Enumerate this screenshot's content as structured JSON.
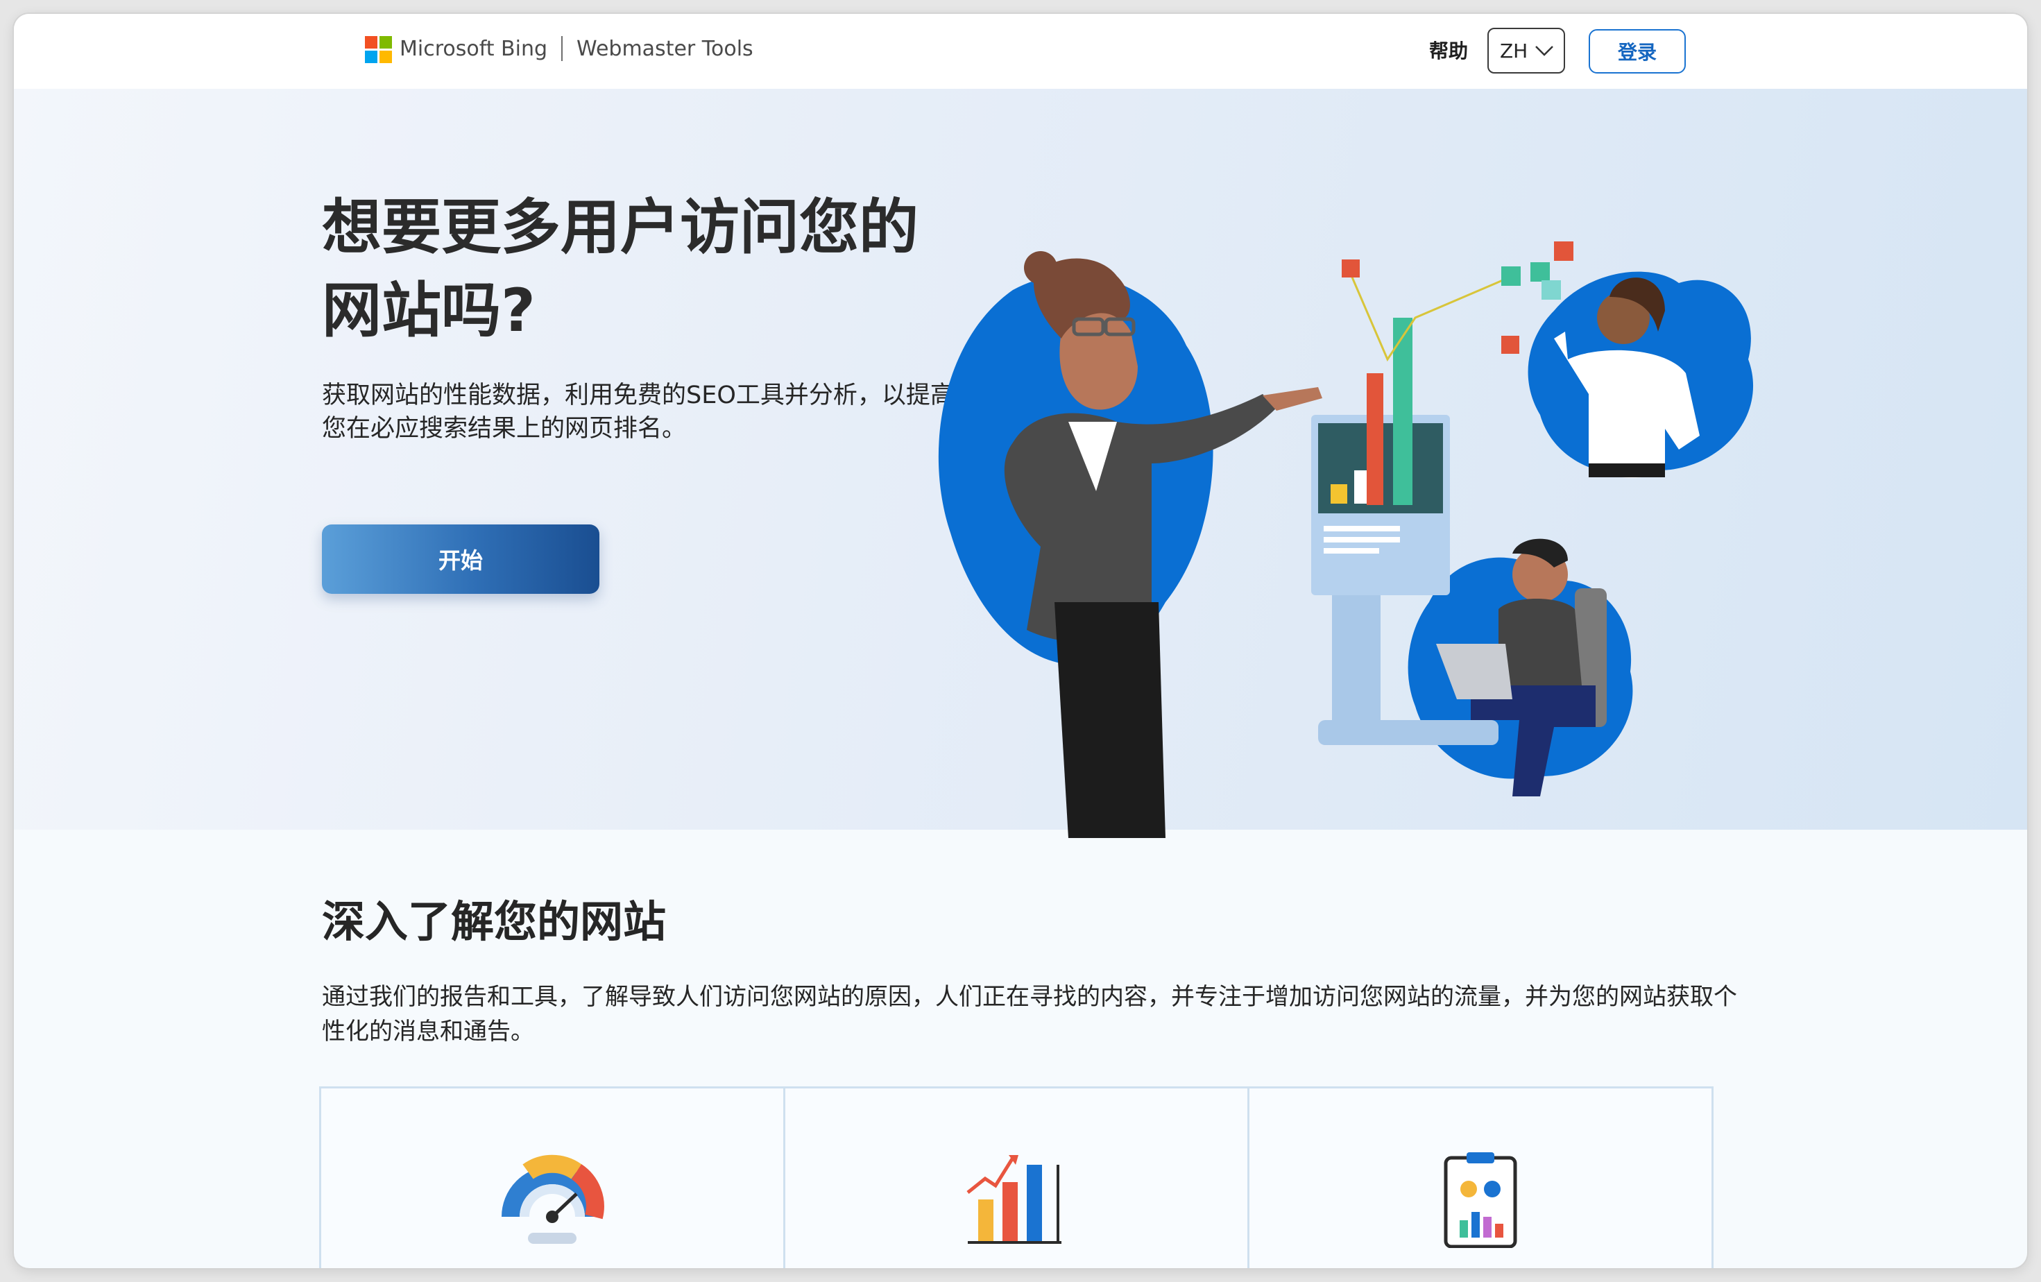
{
  "header": {
    "brand": "Microsoft Bing",
    "product": "Webmaster Tools",
    "help": "帮助",
    "language": "ZH",
    "signin": "登录"
  },
  "hero": {
    "title": "想要更多用户访问您的网站吗?",
    "description": "获取网站的性能数据，利用免费的SEO工具并分析，以提高您在必应搜索结果上的网页排名。",
    "cta": "开始"
  },
  "insights": {
    "title": "深入了解您的网站",
    "description": "通过我们的报告和工具，了解导致人们访问您网站的原因，人们正在寻找的内容，并专注于增加访问您网站的流量，并为您的网站获取个性化的消息和通告。",
    "cards": [
      {
        "icon": "speedometer-icon"
      },
      {
        "icon": "bar-chart-icon"
      },
      {
        "icon": "clipboard-report-icon"
      }
    ]
  },
  "colors": {
    "accent": "#1a73d1",
    "cta_start": "#5b9fd9",
    "cta_end": "#1a4e91",
    "blob_blue": "#0a6fd3"
  }
}
